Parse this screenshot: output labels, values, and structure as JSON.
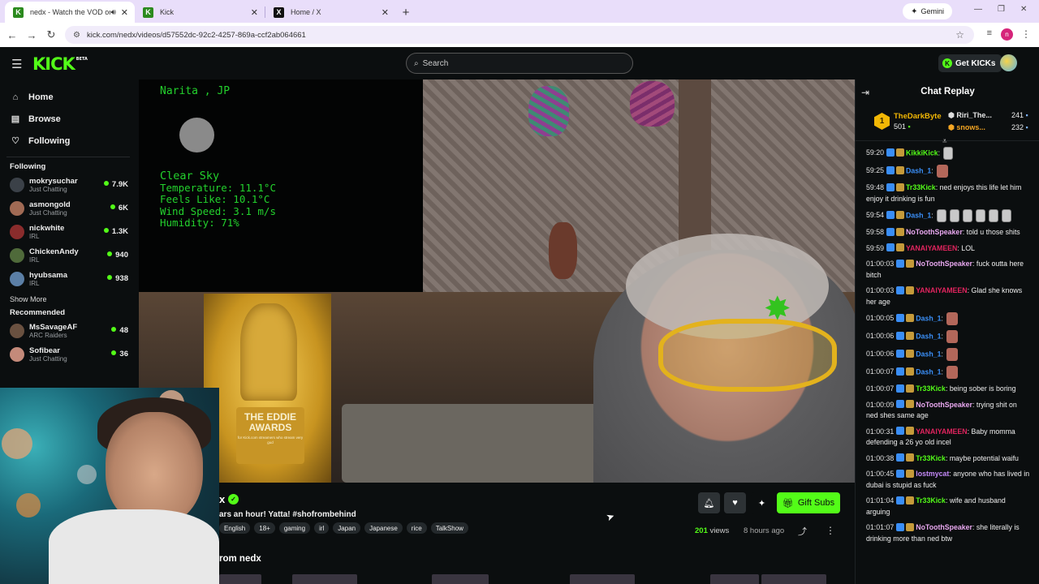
{
  "browser": {
    "tabs": [
      {
        "title": "nedx - Watch the VOD on",
        "icon": "kick-favicon",
        "active": true,
        "audio": true
      },
      {
        "title": "Kick",
        "icon": "kick-favicon",
        "active": false,
        "audio": false
      },
      {
        "title": "Home / X",
        "icon": "x-favicon",
        "active": false,
        "audio": false
      }
    ],
    "gemini_label": "Gemini",
    "url": "kick.com/nedx/videos/d57552dc-92c2-4257-869a-ccf2ab064661",
    "profile_initial": "n"
  },
  "header": {
    "logo": "KICK",
    "logo_badge": "BETA",
    "search_placeholder": "Search",
    "get_kicks_label": "Get KICKs"
  },
  "sidebar": {
    "nav": [
      {
        "label": "Home",
        "icon": "home-icon"
      },
      {
        "label": "Browse",
        "icon": "browse-icon"
      },
      {
        "label": "Following",
        "icon": "heart-icon"
      }
    ],
    "following_title": "Following",
    "following": [
      {
        "name": "mokrysuchar",
        "category": "Just Chatting",
        "viewers": "7.9K",
        "avatar_color": "#3b4148"
      },
      {
        "name": "asmongold",
        "category": "Just Chatting",
        "viewers": "6K",
        "avatar_color": "#a06a54"
      },
      {
        "name": "nickwhite",
        "category": "IRL",
        "viewers": "1.3K",
        "avatar_color": "#8a2c2c"
      },
      {
        "name": "ChickenAndy",
        "category": "IRL",
        "viewers": "940",
        "avatar_color": "#4f6a3a"
      },
      {
        "name": "hyubsama",
        "category": "IRL",
        "viewers": "938",
        "avatar_color": "#5b7fa6"
      }
    ],
    "show_more": "Show More",
    "recommended_title": "Recommended",
    "recommended": [
      {
        "name": "MsSavageAF",
        "category": "ARC Raiders",
        "viewers": "48",
        "avatar_color": "#6a5140"
      },
      {
        "name": "Sofibear",
        "category": "Just Chatting",
        "viewers": "36",
        "avatar_color": "#c48a7a"
      }
    ]
  },
  "video_overlay": {
    "location": "Narita , JP",
    "weather": [
      "Clear Sky",
      "Temperature: 11.1°C",
      "Feels Like: 10.1°C",
      "Wind Speed: 3.1 m/s",
      "Humidity: 71%"
    ],
    "award_title": "THE EDDIE AWARDS",
    "award_sub": "for Kick.com streamers who stream very gud"
  },
  "video_info": {
    "streamer": "x",
    "title": "ars an hour! Yatta! #shofrombehind",
    "tags": [
      "English",
      "18+",
      "gaming",
      "irl",
      "Japan",
      "Japanese",
      "rice",
      "TalkShow"
    ],
    "gift_label": "Gift Subs",
    "views_count": "201",
    "views_label": "views",
    "ago": "8 hours ago",
    "more_from": "rom nedx"
  },
  "chat": {
    "title": "Chat Replay",
    "leaderboard": {
      "top": {
        "rank": "1",
        "name": "TheDarkByte",
        "score": "501"
      },
      "others": [
        {
          "name": "Riri_The...",
          "value": "241",
          "color": "#ffffff"
        },
        {
          "name": "snows...",
          "value": "232",
          "color": "#f5a623"
        }
      ]
    },
    "messages": [
      {
        "time": "59:20",
        "user": "KikkiKick",
        "color": "#53fc18",
        "text": "",
        "emotes": 1,
        "emote_type": "can"
      },
      {
        "time": "59:25",
        "user": "Dash_1",
        "color": "#3a8ef6",
        "text": "",
        "emotes": 1,
        "emote_type": "face"
      },
      {
        "time": "59:48",
        "user": "Tr33Kick",
        "color": "#53fc18",
        "text": "ned enjoys this life let him enjoy it drinking is fun",
        "emotes": 0,
        "emote_type": ""
      },
      {
        "time": "59:54",
        "user": "Dash_1",
        "color": "#3a8ef6",
        "text": "",
        "emotes": 6,
        "emote_type": "can"
      },
      {
        "time": "59:58",
        "user": "NoToothSpeaker",
        "color": "#e9a8f0",
        "text": "told u those shits",
        "emotes": 0,
        "emote_type": ""
      },
      {
        "time": "59:59",
        "user": "YANAIYAMEEN",
        "color": "#e0245e",
        "text": "LOL",
        "emotes": 0,
        "emote_type": ""
      },
      {
        "time": "01:00:03",
        "user": "NoToothSpeaker",
        "color": "#e9a8f0",
        "text": "fuck outta here bitch",
        "emotes": 0,
        "emote_type": ""
      },
      {
        "time": "01:00:03",
        "user": "YANAIYAMEEN",
        "color": "#e0245e",
        "text": "Glad she knows her age",
        "emotes": 0,
        "emote_type": ""
      },
      {
        "time": "01:00:05",
        "user": "Dash_1",
        "color": "#3a8ef6",
        "text": "",
        "emotes": 1,
        "emote_type": "face"
      },
      {
        "time": "01:00:06",
        "user": "Dash_1",
        "color": "#3a8ef6",
        "text": "",
        "emotes": 1,
        "emote_type": "face"
      },
      {
        "time": "01:00:06",
        "user": "Dash_1",
        "color": "#3a8ef6",
        "text": "",
        "emotes": 1,
        "emote_type": "face"
      },
      {
        "time": "01:00:07",
        "user": "Dash_1",
        "color": "#3a8ef6",
        "text": "",
        "emotes": 1,
        "emote_type": "face"
      },
      {
        "time": "01:00:07",
        "user": "Tr33Kick",
        "color": "#53fc18",
        "text": "being sober is boring",
        "emotes": 0,
        "emote_type": ""
      },
      {
        "time": "01:00:09",
        "user": "NoToothSpeaker",
        "color": "#e9a8f0",
        "text": "trying shit on ned shes same age",
        "emotes": 0,
        "emote_type": ""
      },
      {
        "time": "01:00:31",
        "user": "YANAIYAMEEN",
        "color": "#e0245e",
        "text": "Baby momma defending a 26 yo old incel",
        "emotes": 0,
        "emote_type": ""
      },
      {
        "time": "01:00:38",
        "user": "Tr33Kick",
        "color": "#53fc18",
        "text": "maybe potential waifu",
        "emotes": 0,
        "emote_type": ""
      },
      {
        "time": "01:00:45",
        "user": "lostmycat",
        "color": "#c58af9",
        "text": "anyone who has lived in dubai is stupid as fuck",
        "emotes": 0,
        "emote_type": ""
      },
      {
        "time": "01:01:04",
        "user": "Tr33Kick",
        "color": "#53fc18",
        "text": "wife and husband arguing",
        "emotes": 0,
        "emote_type": ""
      },
      {
        "time": "01:01:07",
        "user": "NoToothSpeaker",
        "color": "#e9a8f0",
        "text": "she literally is drinking more than ned btw",
        "emotes": 0,
        "emote_type": ""
      }
    ]
  }
}
